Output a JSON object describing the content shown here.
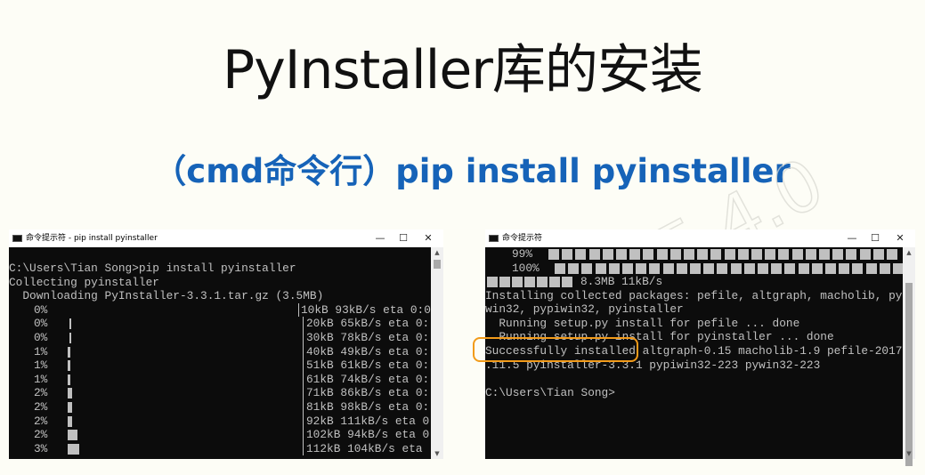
{
  "slide": {
    "title": "PyInstaller库的安装",
    "subtitle": "（cmd命令行）pip install pyinstaller",
    "watermark": "嵩天 4.0"
  },
  "left_window": {
    "title": "命令提示符 - pip  install pyinstaller",
    "buttons": {
      "minimize": "—",
      "maximize": "☐",
      "close": "✕"
    },
    "lines": [
      "C:\\Users\\Tian Song>pip install pyinstaller",
      "Collecting pyinstaller",
      "  Downloading PyInstaller-3.3.1.tar.gz (3.5MB)"
    ],
    "progress_rows": [
      {
        "pct": "0%",
        "status": "10kB 93kB/s eta 0:0",
        "fraction": 0.0
      },
      {
        "pct": "0%",
        "status": "20kB 65kB/s eta 0:",
        "fraction": 0.0
      },
      {
        "pct": "0%",
        "status": "30kB 78kB/s eta 0:",
        "fraction": 0.0
      },
      {
        "pct": "1%",
        "status": "40kB 49kB/s eta 0:",
        "fraction": 0.01
      },
      {
        "pct": "1%",
        "status": "51kB 61kB/s eta 0:",
        "fraction": 0.01
      },
      {
        "pct": "1%",
        "status": "61kB 74kB/s eta 0:",
        "fraction": 0.01
      },
      {
        "pct": "2%",
        "status": "71kB 86kB/s eta 0:",
        "fraction": 0.02
      },
      {
        "pct": "2%",
        "status": "81kB 98kB/s eta 0:",
        "fraction": 0.02
      },
      {
        "pct": "2%",
        "status": "92kB 111kB/s eta 0",
        "fraction": 0.02
      },
      {
        "pct": "2%",
        "status": "102kB 94kB/s eta 0",
        "fraction": 0.02
      },
      {
        "pct": "3%",
        "status": "112kB 104kB/s eta",
        "fraction": 0.03
      }
    ]
  },
  "right_window": {
    "title": "命令提示符",
    "buttons": {
      "minimize": "—",
      "maximize": "☐",
      "close": "✕"
    },
    "progress_rows": [
      {
        "pct": "99%",
        "fraction": 0.99
      },
      {
        "pct": "100%",
        "fraction": 1.0
      }
    ],
    "speed": "8.3MB 11kB/s",
    "lines": [
      "Installing collected packages: pefile, altgraph, macholib, py",
      "win32, pypiwin32, pyinstaller",
      "  Running setup.py install for pefile ... done",
      "  Running setup.py install for pyinstaller ... done",
      "Successfully installed altgraph-0.15 macholib-1.9 pefile-2017",
      ".11.5 pyinstaller-3.3.1 pypiwin32-223 pywin32-223",
      "",
      "C:\\Users\\Tian Song>"
    ],
    "highlighted_text": "Successfully installed"
  },
  "colors": {
    "subtitle": "#1663b8",
    "console_bg": "#0c0c0c",
    "console_fg": "#c0c0c0",
    "highlight": "#f29b1a"
  }
}
